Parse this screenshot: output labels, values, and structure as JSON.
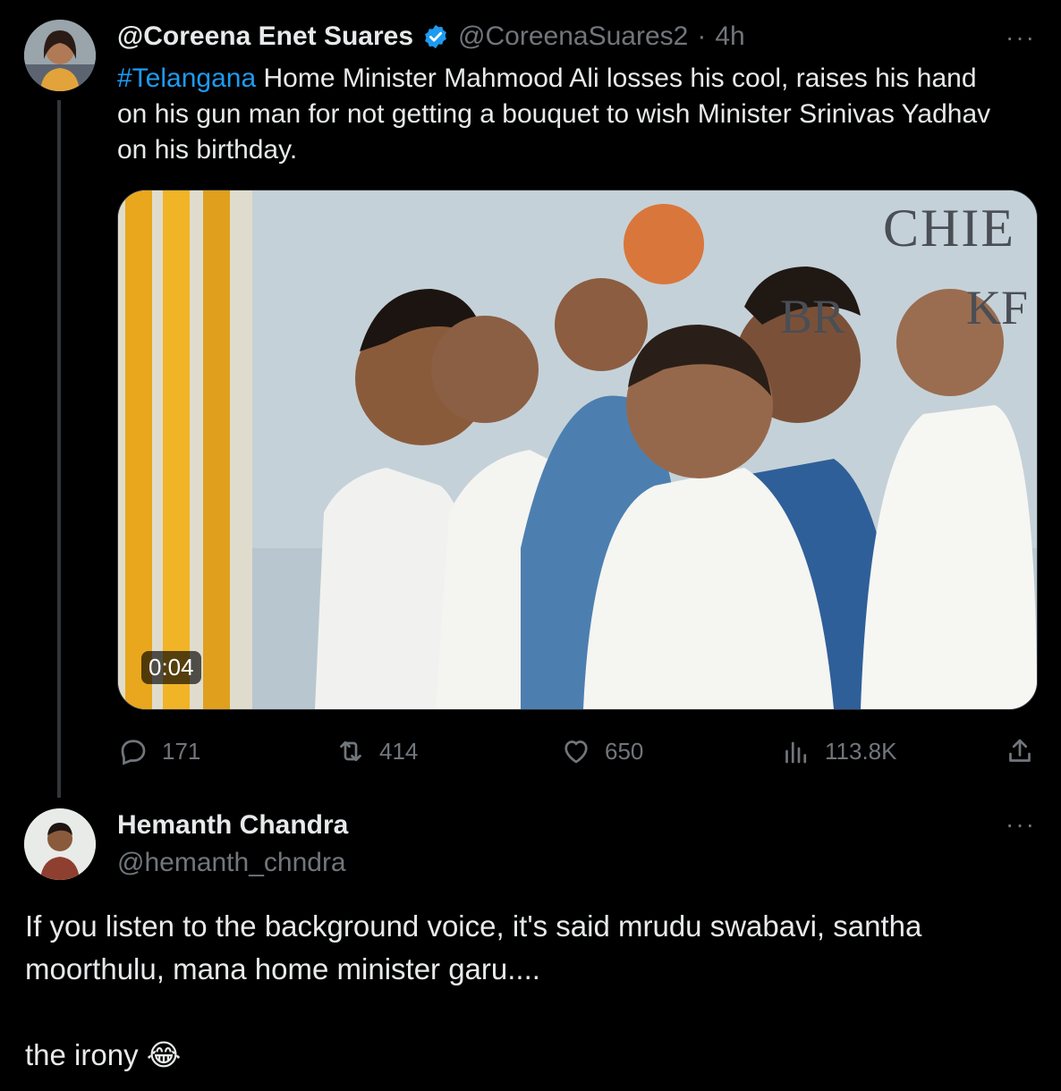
{
  "tweet": {
    "display_name": "@Coreena Enet Suares",
    "handle": "@CoreenaSuares2",
    "separator": "·",
    "time": "4h",
    "verified_icon": "verified-badge-icon",
    "text_hashtag": "#Telangana",
    "text_line1_rest": " Home Minister Mahmood Ali losses his cool, raises his hand",
    "text_line2": "on his gun man for not getting a bouquet to wish Minister Srinivas Yadhav",
    "text_line3": "on his birthday.",
    "more_label": "···",
    "media": {
      "duration": "0:04",
      "banner_line1": "CHIE",
      "banner_line2": "BR",
      "banner_line2_end": "KF"
    },
    "stats": {
      "replies": "171",
      "retweets": "414",
      "likes": "650",
      "views": "113.8K"
    }
  },
  "reply": {
    "display_name": "Hemanth Chandra",
    "handle": "@hemanth_chndra",
    "more_label": "···",
    "line1": "If you listen to the background voice, it's said mrudu swabavi, santha",
    "line2": "moorthulu, mana home minister garu....",
    "line3": "the irony",
    "emoji": "😂"
  },
  "colors": {
    "background": "#000000",
    "text": "#e7e9ea",
    "muted": "#71767b",
    "accent": "#1d9bf0",
    "thread_line": "#333639"
  }
}
